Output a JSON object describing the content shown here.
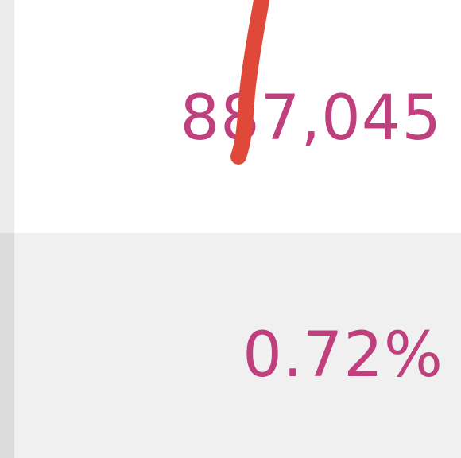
{
  "cells": {
    "top": {
      "value": "887,045"
    },
    "bottom": {
      "value": "0.72%"
    }
  },
  "annotation": {
    "color": "#e0493a"
  },
  "colors": {
    "value_text": "#c0407e",
    "top_bg": "#ffffff",
    "bottom_bg": "#f0f0f0"
  }
}
